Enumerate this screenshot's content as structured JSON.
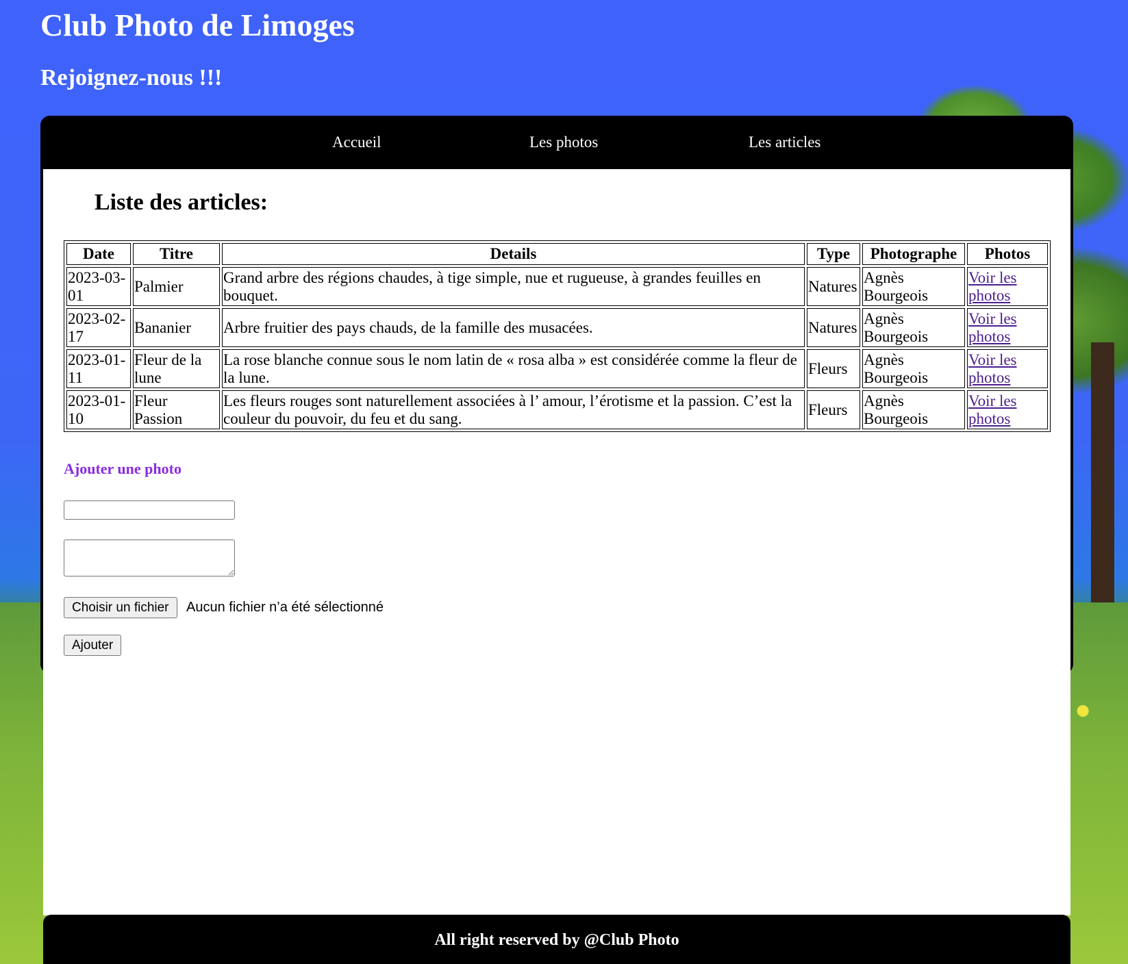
{
  "header": {
    "title": "Club Photo de Limoges",
    "subtitle": "Rejoignez-nous !!!"
  },
  "nav": {
    "items": [
      {
        "label": "Accueil"
      },
      {
        "label": "Les photos"
      },
      {
        "label": "Les articles"
      }
    ]
  },
  "main": {
    "heading": "Liste des articles:",
    "table": {
      "columns": [
        "Date",
        "Titre",
        "Details",
        "Type",
        "Photographe",
        "Photos"
      ],
      "rows": [
        {
          "date": "2023-03-01",
          "titre": "Palmier",
          "details": "Grand arbre des régions chaudes, à tige simple, nue et rugueuse, à grandes feuilles en bouquet.",
          "type": "Natures",
          "photographe": "Agnès Bourgeois",
          "photos_link": "Voir les photos"
        },
        {
          "date": "2023-02-17",
          "titre": "Bananier",
          "details": "Arbre fruitier des pays chauds, de la famille des musacées.",
          "type": "Natures",
          "photographe": "Agnès Bourgeois",
          "photos_link": "Voir les photos"
        },
        {
          "date": "2023-01-11",
          "titre": "Fleur de la lune",
          "details": "La rose blanche connue sous le nom latin de « rosa alba » est considérée comme la fleur de la lune.",
          "type": "Fleurs",
          "photographe": "Agnès Bourgeois",
          "photos_link": "Voir les photos"
        },
        {
          "date": "2023-01-10",
          "titre": "Fleur Passion",
          "details": "Les fleurs rouges sont naturellement associées à l’ amour, l’érotisme et la passion. C’est la couleur du pouvoir, du feu et du sang.",
          "type": "Fleurs",
          "photographe": "Agnès Bourgeois",
          "photos_link": "Voir les photos"
        }
      ]
    },
    "form": {
      "heading": "Ajouter une photo",
      "title_input": {
        "value": "",
        "placeholder": ""
      },
      "description_input": {
        "value": "",
        "placeholder": ""
      },
      "file_button_label": "Choisir un fichier",
      "file_status": "Aucun fichier n’a été sélectionné",
      "submit_label": "Ajouter"
    }
  },
  "footer": {
    "text": "All right reserved by @Club Photo"
  },
  "colors": {
    "background_sky": "#3f62fb",
    "nav_background": "#000000",
    "form_heading": "#8a2be2",
    "visited_link": "#4b1d8f"
  }
}
